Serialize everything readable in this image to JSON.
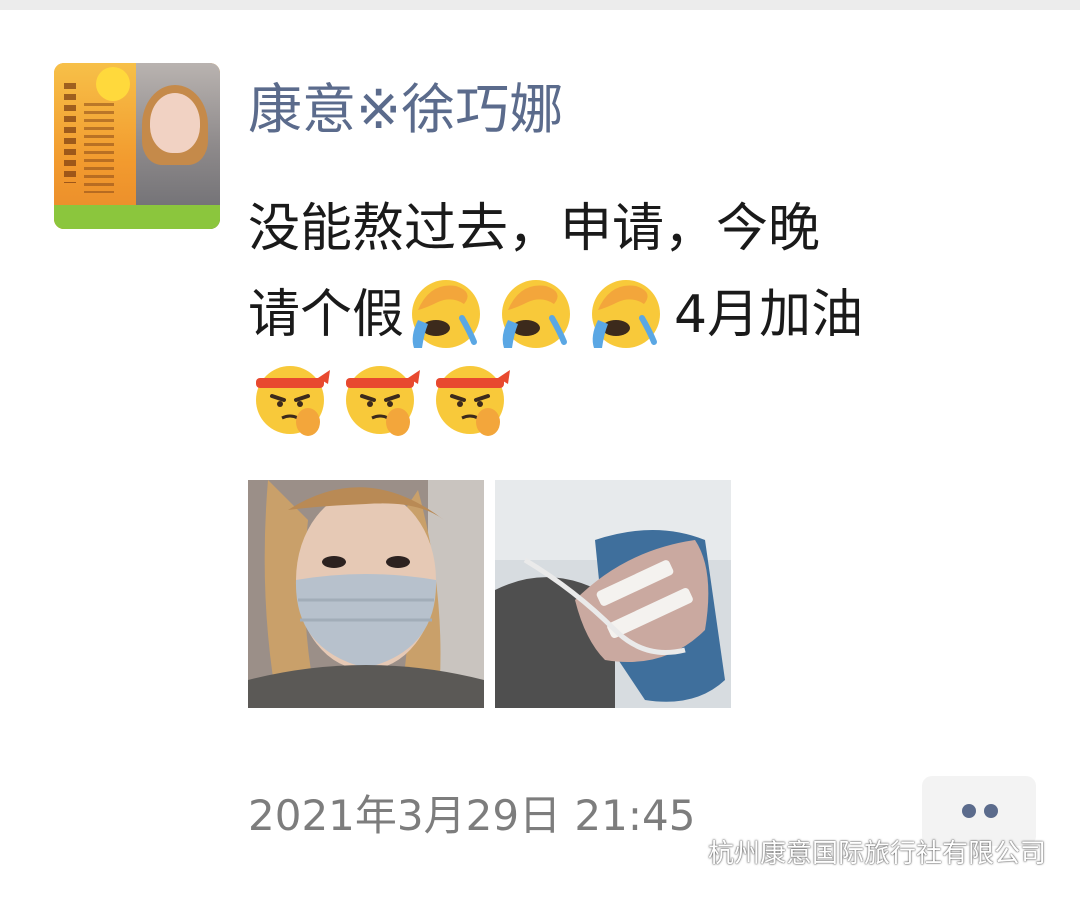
{
  "post": {
    "username": "康意※徐巧娜",
    "text_lines": [
      "没能熬过去，申请，今晚",
      "请个假",
      "4月加油"
    ],
    "emojis": [
      "face-palm-crying-emoji",
      "face-palm-crying-emoji",
      "face-palm-crying-emoji",
      "determined-headband-emoji",
      "determined-headband-emoji",
      "determined-headband-emoji"
    ],
    "timestamp": "2021年3月29日 21:45",
    "photos": [
      "selfie-with-mask-photo",
      "hand-iv-drip-photo"
    ]
  },
  "watermark": {
    "text": "杭州康意国际旅行社有限公司"
  },
  "colors": {
    "username": "#5b6b8c",
    "text": "#1a1a1a",
    "timestamp": "#7d7d7d",
    "more_dots": "#5b6b8c"
  }
}
